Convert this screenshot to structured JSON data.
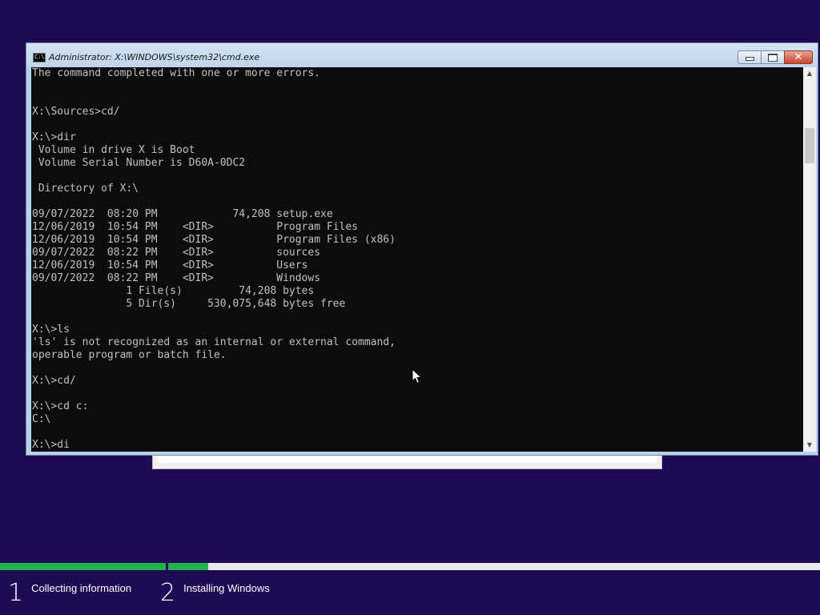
{
  "window": {
    "title": "Administrator: X:\\WINDOWS\\system32\\cmd.exe",
    "icon": "cmd-icon",
    "icon_label": "C:\\"
  },
  "console": {
    "lines": [
      "The command completed with one or more errors.",
      "",
      "",
      "X:\\Sources>cd/",
      "",
      "X:\\>dir",
      " Volume in drive X is Boot",
      " Volume Serial Number is D60A-0DC2",
      "",
      " Directory of X:\\",
      "",
      "09/07/2022  08:20 PM            74,208 setup.exe",
      "12/06/2019  10:54 PM    <DIR>          Program Files",
      "12/06/2019  10:54 PM    <DIR>          Program Files (x86)",
      "09/07/2022  08:22 PM    <DIR>          sources",
      "12/06/2019  10:54 PM    <DIR>          Users",
      "09/07/2022  08:22 PM    <DIR>          Windows",
      "               1 File(s)         74,208 bytes",
      "               5 Dir(s)     530,075,648 bytes free",
      "",
      "X:\\>ls",
      "'ls' is not recognized as an internal or external command,",
      "operable program or batch file.",
      "",
      "X:\\>cd/",
      "",
      "X:\\>cd c:",
      "C:\\",
      "",
      "X:\\>di"
    ]
  },
  "progress": {
    "steps": [
      {
        "number": "1",
        "label": "Collecting information",
        "fill": 1.0
      },
      {
        "number": "2",
        "label": "Installing Windows",
        "fill": 0.061
      }
    ]
  },
  "colors": {
    "desktop": "#1e0a54",
    "progress_fill": "#23b14d",
    "console_bg": "#0c0c0c",
    "console_fg": "#c0c0c0"
  }
}
